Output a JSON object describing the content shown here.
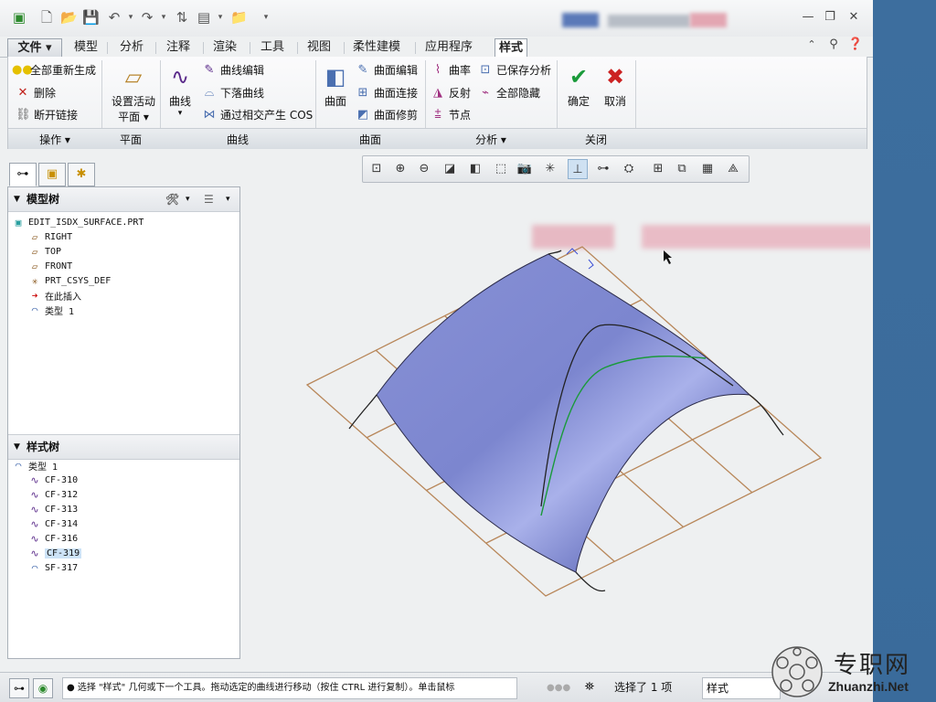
{
  "ribbon_tabs": [
    "文件 ▾",
    "模型",
    "分析",
    "注释",
    "渲染",
    "工具",
    "视图",
    "柔性建模",
    "应用程序",
    "样式"
  ],
  "ops": {
    "regen": "全部重新生成",
    "delete": "删除",
    "break_link": "断开链接",
    "group": "操作 ▾"
  },
  "plane": {
    "label": "设置活动",
    "sub": "平面 ▾",
    "group": "平面"
  },
  "curve": {
    "big": "曲线",
    "edit": "曲线编辑",
    "drop": "下落曲线",
    "cos": "通过相交产生 COS",
    "group": "曲线"
  },
  "surface": {
    "big": "曲面",
    "edit": "曲面编辑",
    "connect": "曲面连接",
    "trim": "曲面修剪",
    "group": "曲面"
  },
  "analysis": {
    "curvature": "曲率",
    "saved": "已保存分析",
    "reflect": "反射",
    "hide_all": "全部隐藏",
    "nodes": "节点",
    "group": "分析 ▾"
  },
  "close": {
    "ok": "确定",
    "cancel": "取消",
    "group": "关闭"
  },
  "model_tree": {
    "title": "模型树",
    "items": [
      "EDIT_ISDX_SURFACE.PRT",
      "RIGHT",
      "TOP",
      "FRONT",
      "PRT_CSYS_DEF",
      "在此插入",
      "类型 1"
    ]
  },
  "style_tree": {
    "title": "样式树",
    "root": "类型 1",
    "items": [
      "CF-310",
      "CF-312",
      "CF-313",
      "CF-314",
      "CF-316",
      "CF-319",
      "SF-317"
    ]
  },
  "status": {
    "message": "● 选择 \"样式\" 几何或下一个工具。拖动选定的曲线进行移动（按住 CTRL 进行复制）。单击鼠标",
    "selected": "选择了 1 项",
    "filter": "样式"
  },
  "watermark": {
    "cn": "专职网",
    "en": "Zhuanzhi.Net"
  },
  "colors": {
    "surface": "#7f89d0",
    "grid": "#b8875a",
    "accent_green": "#1a9a3a",
    "accent_red": "#cc2222",
    "curve": "#5a2a8a"
  }
}
